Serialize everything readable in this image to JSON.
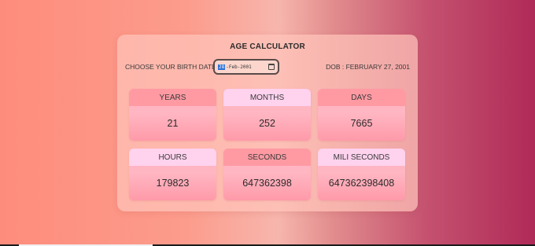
{
  "calculator": {
    "title": "AGE CALCULATOR",
    "dob_label": "CHOOSE YOUR BIRTH DATE",
    "date_input": {
      "day": "28",
      "rest": "-Feb-2001"
    },
    "dob_text": "DOB : FEBRUARY 27, 2001"
  },
  "stats": [
    {
      "label": "YEARS",
      "value": "21"
    },
    {
      "label": "MONTHS",
      "value": "252"
    },
    {
      "label": "DAYS",
      "value": "7665"
    },
    {
      "label": "HOURS",
      "value": "179823"
    },
    {
      "label": "SECONDS",
      "value": "647362398"
    },
    {
      "label": "MILI SECONDS",
      "value": "647362398408"
    }
  ],
  "colors": {
    "header_pink": "#ff9aa3",
    "header_light_pink": "#ffd2ee",
    "selected_day": "#2b6fd6"
  },
  "icons": {
    "date_picker": "calendar-icon"
  }
}
